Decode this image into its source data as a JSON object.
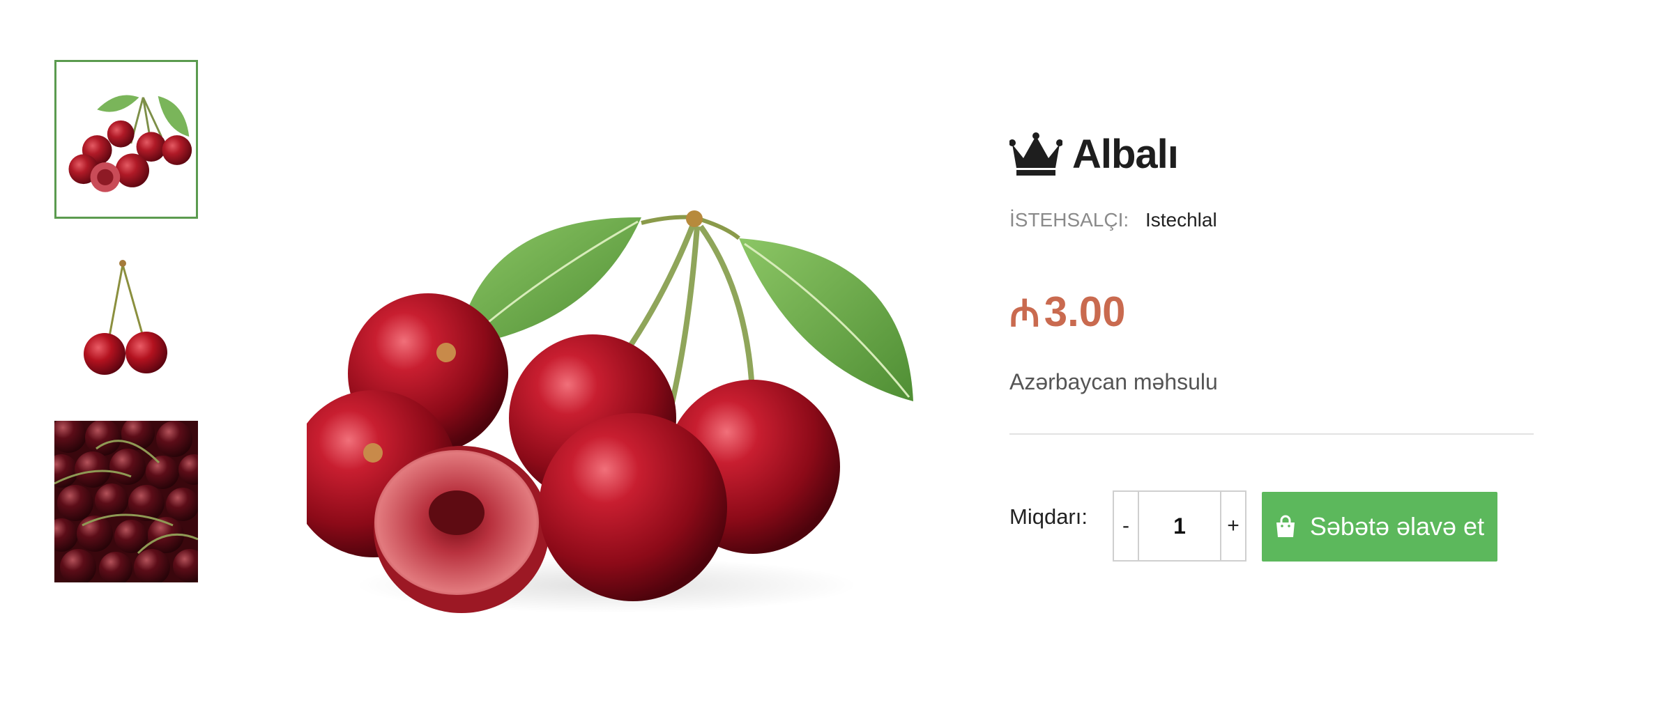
{
  "product": {
    "title": "Albalı",
    "maker_label": "İSTEHSALÇI:",
    "maker_value": "Istechlal",
    "price_symbol": "₼",
    "price_value": "3.00",
    "origin": "Azərbaycan məhsulu"
  },
  "quantity": {
    "label": "Miqdarı:",
    "value": "1",
    "minus": "-",
    "plus": "+"
  },
  "cart": {
    "add_label": "Səbətə əlavə et"
  },
  "icons": {
    "title_icon": "crown-icon",
    "cart_icon": "shopping-bag-icon"
  },
  "colors": {
    "accent_green": "#5cb85c",
    "price": "#c96a4f",
    "thumb_border": "#5b9b4f"
  }
}
